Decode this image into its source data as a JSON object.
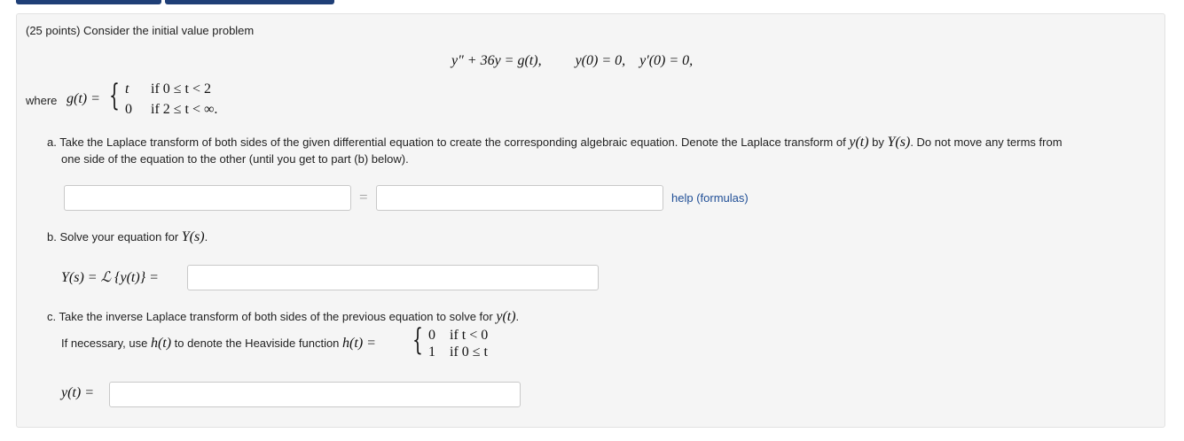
{
  "tabs": [
    "",
    "",
    ""
  ],
  "problem": {
    "intro": "(25 points) Consider the initial value problem",
    "ode": "y″ + 36y = g(t),",
    "ic1": "y(0) = 0,",
    "ic2": "y′(0) = 0,",
    "where": "where",
    "g_lhs": "g(t) =",
    "case1_expr": "t",
    "case1_cond": "if 0 ≤ t < 2",
    "case2_expr": "0",
    "case2_cond": "if 2 ≤ t < ∞."
  },
  "part_a": {
    "line1_pre": "a. Take the Laplace transform of both sides of the given differential equation to create the corresponding algebraic equation. Denote the Laplace transform of",
    "y_t": "y(t)",
    "by": "by",
    "Y_s": "Y(s)",
    "line1_post": ". Do not move any terms from",
    "line2": "one side of the equation to the other (until you get to part (b) below).",
    "left_value": "",
    "equals": "=",
    "right_value": "",
    "help_link": "help (formulas)"
  },
  "part_b": {
    "text": "b. Solve your equation for",
    "Y_s": "Y(s)",
    "period": ".",
    "lhs": "Y(s) = ℒ {y(t)} =",
    "value": ""
  },
  "part_c": {
    "text": "c. Take the inverse Laplace transform of both sides of the previous equation to solve for",
    "y_t": "y(t)",
    "period": ".",
    "heav_pre": "If necessary, use",
    "h_t": "h(t)",
    "heav_mid": "to denote the Heaviside function",
    "h_lhs": "h(t) =",
    "h_case1_expr": "0",
    "h_case1_cond": "if t < 0",
    "h_case2_expr": "1",
    "h_case2_cond": "if 0 ≤ t",
    "lhs": "y(t) =",
    "value": ""
  }
}
